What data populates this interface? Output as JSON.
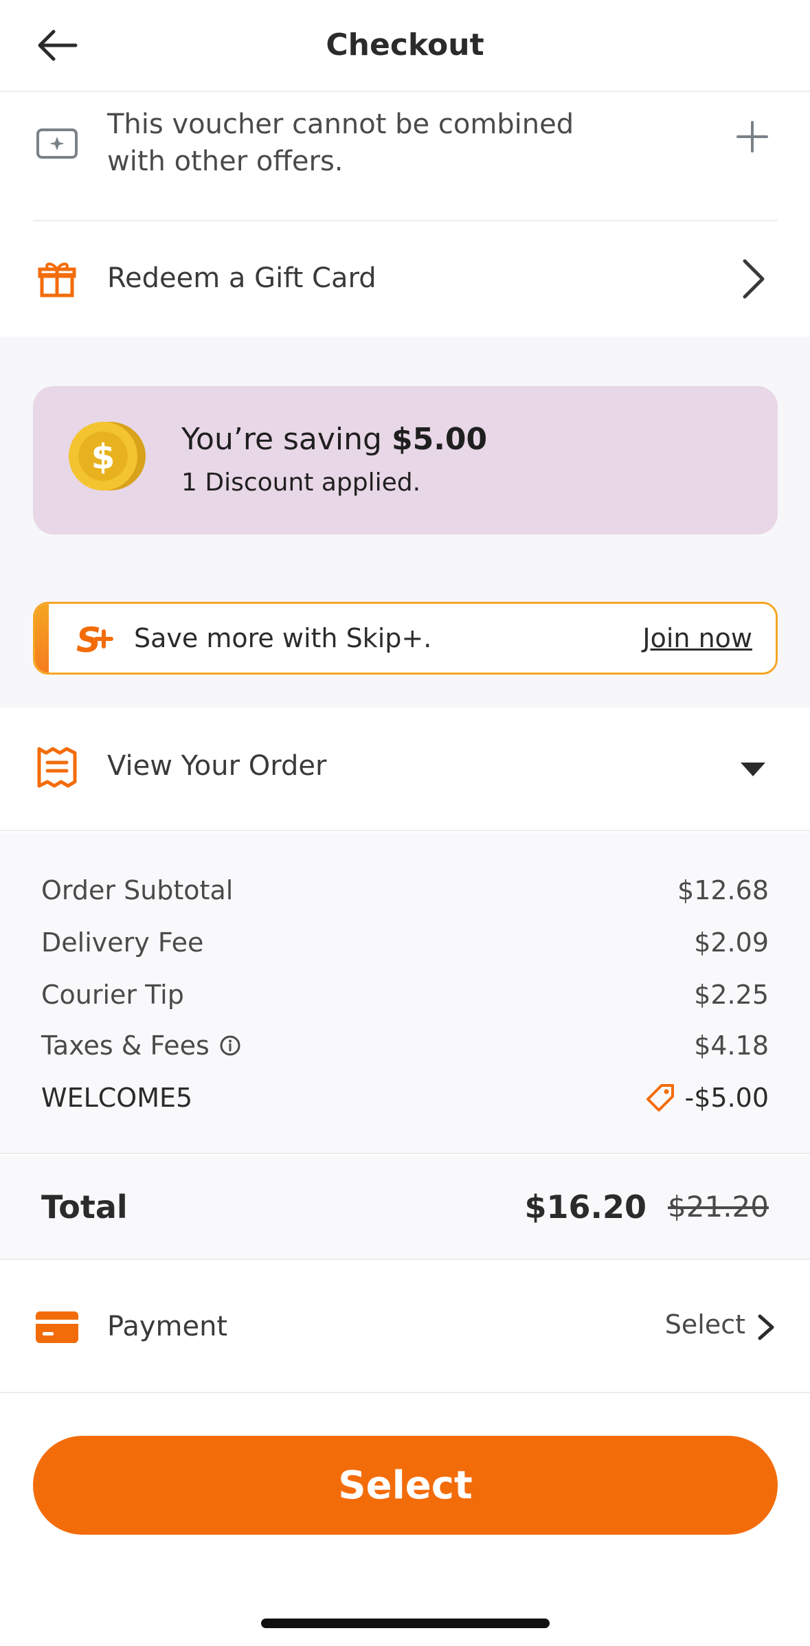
{
  "header": {
    "title": "Checkout",
    "back_icon": "arrow-left-icon"
  },
  "voucher": {
    "text": "This voucher cannot be combined with other offers.",
    "icon": "voucher-icon",
    "add_icon": "plus-icon"
  },
  "gift_card": {
    "label": "Redeem a Gift Card",
    "icon": "gift-icon"
  },
  "savings": {
    "prefix": "You’re saving ",
    "amount": "$5.00",
    "discount_text": "1 Discount applied.",
    "icon": "coin-icon",
    "card_color": "#e8d7e6"
  },
  "skip_plus": {
    "text": "Save more with Skip+.",
    "link": "Join now",
    "icon": "skip-plus-logo-icon",
    "border_color": "#f5a623"
  },
  "order": {
    "label": "View Your Order",
    "icon": "receipt-icon"
  },
  "fees": [
    {
      "label": "Order Subtotal",
      "value": "$12.68"
    },
    {
      "label": "Delivery Fee",
      "value": "$2.09"
    },
    {
      "label": "Courier Tip",
      "value": "$2.25"
    },
    {
      "label": "Taxes & Fees",
      "value": "$4.18",
      "info_icon": "info-icon"
    },
    {
      "label": "WELCOME5",
      "value": "-$5.00",
      "tag_icon": "tag-icon"
    }
  ],
  "total": {
    "label": "Total",
    "value": "$16.20",
    "original": "$21.20"
  },
  "payment": {
    "label": "Payment",
    "action": "Select",
    "icon": "credit-card-icon"
  },
  "cta": {
    "label": "Select",
    "color": "#f36c0a"
  },
  "accent_color": "#f36c0a"
}
